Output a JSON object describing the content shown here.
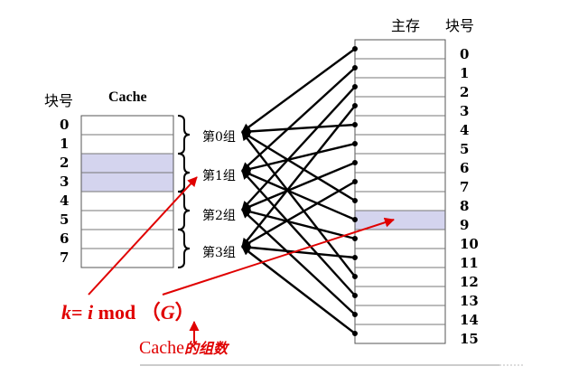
{
  "cache": {
    "header_block": "块号",
    "header_title": "Cache",
    "block_numbers": [
      "0",
      "1",
      "2",
      "3",
      "4",
      "5",
      "6",
      "7"
    ],
    "highlighted_rows": [
      2,
      3
    ]
  },
  "groups": {
    "labels": [
      "第0组",
      "第1组",
      "第2组",
      "第3组"
    ]
  },
  "main_memory": {
    "header_title": "主存",
    "header_block": "块号",
    "block_numbers": [
      "0",
      "1",
      "2",
      "3",
      "4",
      "5",
      "6",
      "7",
      "8",
      "9",
      "10",
      "11",
      "12",
      "13",
      "14",
      "15"
    ],
    "highlighted_row": 9
  },
  "formula": {
    "k": "k",
    "eq": "=",
    "i": "i",
    "mod": "mod",
    "lp": "（",
    "G": "G",
    "rp": "）"
  },
  "caption": {
    "prefix": "Cache",
    "suffix": "的组数"
  },
  "colors": {
    "arrow_black": "#000000",
    "annotation_red": "#e00000",
    "highlight": "#d4d4ee"
  }
}
